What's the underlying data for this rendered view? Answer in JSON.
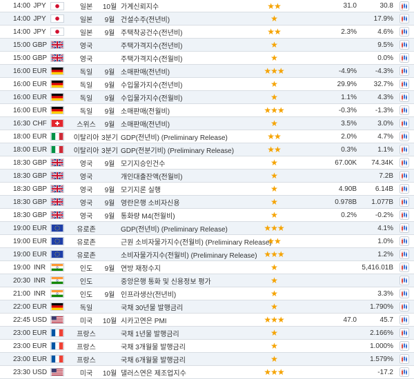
{
  "events": [
    {
      "time": "14:00",
      "currency": "JPY",
      "flag": "jp-flag",
      "country": "일본",
      "period": "10월",
      "event": "가계신뢰지수",
      "stars": "★★",
      "actual": "31.0",
      "forecast": "30.8"
    },
    {
      "time": "14:00",
      "currency": "JPY",
      "flag": "jp-flag",
      "country": "일본",
      "period": "9월",
      "event": "건설수주(전년비)",
      "stars": "★",
      "actual": "",
      "forecast": "17.9%"
    },
    {
      "time": "14:00",
      "currency": "JPY",
      "flag": "jp-flag",
      "country": "일본",
      "period": "9월",
      "event": "주택착공건수(전년비)",
      "stars": "★★",
      "actual": "2.3%",
      "forecast": "4.6%"
    },
    {
      "time": "15:00",
      "currency": "GBP",
      "flag": "gb-flag",
      "country": "영국",
      "period": "",
      "event": "주택가격지수(전년비)",
      "stars": "★",
      "actual": "",
      "forecast": "9.5%"
    },
    {
      "time": "15:00",
      "currency": "GBP",
      "flag": "gb-flag",
      "country": "영국",
      "period": "",
      "event": "주택가격지수(전월비)",
      "stars": "★",
      "actual": "",
      "forecast": "0.0%"
    },
    {
      "time": "16:00",
      "currency": "EUR",
      "flag": "de-flag",
      "country": "독일",
      "period": "9월",
      "event": "소매판매(전년비)",
      "stars": "★★★",
      "actual": "-4.9%",
      "forecast": "-4.3%"
    },
    {
      "time": "16:00",
      "currency": "EUR",
      "flag": "de-flag",
      "country": "독일",
      "period": "9월",
      "event": "수입물가지수(전년비)",
      "stars": "★",
      "actual": "29.9%",
      "forecast": "32.7%"
    },
    {
      "time": "16:00",
      "currency": "EUR",
      "flag": "de-flag",
      "country": "독일",
      "period": "9월",
      "event": "수입물가지수(전월비)",
      "stars": "★",
      "actual": "1.1%",
      "forecast": "4.3%"
    },
    {
      "time": "16:00",
      "currency": "EUR",
      "flag": "de-flag",
      "country": "독일",
      "period": "9월",
      "event": "소매판매(전월비)",
      "stars": "★★★",
      "actual": "-0.3%",
      "forecast": "-1.3%"
    },
    {
      "time": "16:30",
      "currency": "CHF",
      "flag": "ch-flag",
      "country": "스위스",
      "period": "9월",
      "event": "소매판매(전년비)",
      "stars": "★",
      "actual": "3.5%",
      "forecast": "3.0%"
    },
    {
      "time": "18:00",
      "currency": "EUR",
      "flag": "it-flag",
      "country": "이탈리아",
      "period": "3분기",
      "event": "GDP(전년비) (Preliminary Release)",
      "stars": "★★",
      "actual": "2.0%",
      "forecast": "4.7%"
    },
    {
      "time": "18:00",
      "currency": "EUR",
      "flag": "it-flag",
      "country": "이탈리아",
      "period": "3분기",
      "event": "GDP(전분기비) (Preliminary Release)",
      "stars": "★★",
      "actual": "0.3%",
      "forecast": "1.1%"
    },
    {
      "time": "18:30",
      "currency": "GBP",
      "flag": "gb-flag",
      "country": "영국",
      "period": "9월",
      "event": "모기지승인건수",
      "stars": "★",
      "actual": "67.00K",
      "forecast": "74.34K"
    },
    {
      "time": "18:30",
      "currency": "GBP",
      "flag": "gb-flag",
      "country": "영국",
      "period": "",
      "event": "개인대출잔액(전월비)",
      "stars": "★",
      "actual": "",
      "forecast": "7.2B"
    },
    {
      "time": "18:30",
      "currency": "GBP",
      "flag": "gb-flag",
      "country": "영국",
      "period": "9월",
      "event": "모기지론 실행",
      "stars": "★",
      "actual": "4.90B",
      "forecast": "6.14B"
    },
    {
      "time": "18:30",
      "currency": "GBP",
      "flag": "gb-flag",
      "country": "영국",
      "period": "9월",
      "event": "영란은행 소비자신용",
      "stars": "★",
      "actual": "0.978B",
      "forecast": "1.077B"
    },
    {
      "time": "18:30",
      "currency": "GBP",
      "flag": "gb-flag",
      "country": "영국",
      "period": "9월",
      "event": "통화량 M4(전월비)",
      "stars": "★",
      "actual": "0.2%",
      "forecast": "-0.2%"
    },
    {
      "time": "19:00",
      "currency": "EUR",
      "flag": "eu-flag",
      "country": "유로존",
      "period": "",
      "event": "GDP(전년비) (Preliminary Release)",
      "stars": "★★★",
      "actual": "",
      "forecast": "4.1%"
    },
    {
      "time": "19:00",
      "currency": "EUR",
      "flag": "eu-flag",
      "country": "유로존",
      "period": "",
      "event": "근원 소비자물가지수(전월비) (Preliminary Release)",
      "stars": "★★",
      "actual": "",
      "forecast": "1.0%"
    },
    {
      "time": "19:00",
      "currency": "EUR",
      "flag": "eu-flag",
      "country": "유로존",
      "period": "",
      "event": "소비자물가지수(전월비) (Preliminary Release)",
      "stars": "★★★",
      "actual": "",
      "forecast": "1.2%"
    },
    {
      "time": "19:00",
      "currency": "INR",
      "flag": "in-flag",
      "country": "인도",
      "period": "9월",
      "event": "연방 재정수지",
      "stars": "★",
      "actual": "",
      "forecast": "5,416.01B"
    },
    {
      "time": "20:30",
      "currency": "INR",
      "flag": "in-flag",
      "country": "인도",
      "period": "",
      "event": "중앙은행 통화 및 신용정보 평가",
      "stars": "★",
      "actual": "",
      "forecast": ""
    },
    {
      "time": "21:00",
      "currency": "INR",
      "flag": "in-flag",
      "country": "인도",
      "period": "9월",
      "event": "인프라생산(전년비)",
      "stars": "★",
      "actual": "",
      "forecast": "3.3%"
    },
    {
      "time": "22:00",
      "currency": "EUR",
      "flag": "de-flag",
      "country": "독일",
      "period": "",
      "event": "국채 30년물 발행금리",
      "stars": "★",
      "actual": "",
      "forecast": "1.790%"
    },
    {
      "time": "22:45",
      "currency": "USD",
      "flag": "us-flag",
      "country": "미국",
      "period": "10월",
      "event": "시카고연은 PMI",
      "stars": "★★★",
      "actual": "47.0",
      "forecast": "45.7"
    },
    {
      "time": "23:00",
      "currency": "EUR",
      "flag": "fr-flag",
      "country": "프랑스",
      "period": "",
      "event": "국채 1년물 발행금리",
      "stars": "★",
      "actual": "",
      "forecast": "2.166%"
    },
    {
      "time": "23:00",
      "currency": "EUR",
      "flag": "fr-flag",
      "country": "프랑스",
      "period": "",
      "event": "국채 3개월물 발행금리",
      "stars": "★",
      "actual": "",
      "forecast": "1.000%"
    },
    {
      "time": "23:00",
      "currency": "EUR",
      "flag": "fr-flag",
      "country": "프랑스",
      "period": "",
      "event": "국채 6개월물 발행금리",
      "stars": "★",
      "actual": "",
      "forecast": "1.579%"
    },
    {
      "time": "23:30",
      "currency": "USD",
      "flag": "us-flag",
      "country": "미국",
      "period": "10월",
      "event": "댈러스연은 제조업지수",
      "stars": "★★★",
      "actual": "",
      "forecast": "-17.2"
    }
  ],
  "colors": {
    "star": "#f5a300",
    "alarm": "#3b6fd1",
    "alt_row": "#eef3f8",
    "divider": "#d8dde3"
  }
}
